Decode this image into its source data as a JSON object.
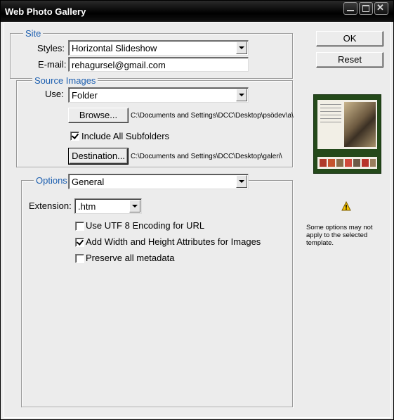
{
  "window": {
    "title": "Web Photo Gallery"
  },
  "site": {
    "legend": "Site",
    "styles_label": "Styles:",
    "styles_value": "Horizontal Slideshow",
    "email_label": "E-mail:",
    "email_value": "rehagursel@gmail.com"
  },
  "source": {
    "legend": "Source Images",
    "use_label": "Use:",
    "use_value": "Folder",
    "browse_label": "Browse...",
    "browse_path": "C:\\Documents and Settings\\DCC\\Desktop\\psödev\\a\\",
    "include_subfolders_label": "Include All Subfolders",
    "include_subfolders_checked": true,
    "destination_label": "Destination...",
    "destination_path": "C:\\Documents and Settings\\DCC\\Desktop\\galeri\\"
  },
  "options": {
    "legend": "Options:",
    "section_value": "General",
    "extension_label": "Extension:",
    "extension_value": ".htm",
    "checkboxes": [
      {
        "label": "Use UTF 8 Encoding for URL",
        "checked": false
      },
      {
        "label": "Add Width and Height Attributes for Images",
        "checked": true
      },
      {
        "label": "Preserve all metadata",
        "checked": false
      }
    ]
  },
  "actions": {
    "ok_label": "OK",
    "reset_label": "Reset"
  },
  "preview": {
    "icon": "template-preview-thumbnail",
    "background_color": "#24491a"
  },
  "warning": {
    "icon": "warning-icon",
    "text": "Some options may not apply to the selected template."
  }
}
